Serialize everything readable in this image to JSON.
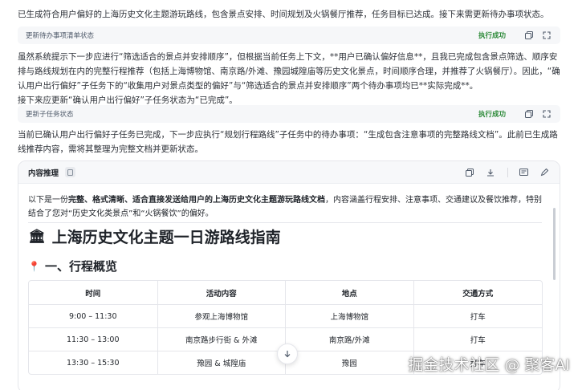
{
  "messages": {
    "p1": "已生成符合用户偏好的上海历史文化主题游玩路线，包含景点安排、时间规划及火锅餐厅推荐，任务目标已达成。接下来需更新待办事项状态。",
    "p2": "虽然系统提示下一步应进行“筛选适合的景点并安排顺序”，但根据当前任务上下文，**用户已确认偏好信息**，且我已完成包含景点筛选、顺序安排与路线规划在内的完整行程推荐（包括上海博物馆、南京路/外滩、豫园城隍庙等历史文化景点，时间顺序合理，并推荐了火锅餐厅）。因此，“确认用户出行偏好”子任务下的“收集用户对景点类型的偏好”与“筛选适合的景点并安排顺序”两个待办事项均已**实际完成**。",
    "p2b": "接下来应更新“确认用户出行偏好”子任务状态为“已完成”。",
    "p3": "当前已确认用户出行偏好子任务已完成，下一步应执行“规划行程路线”子任务中的待办事项：“生成包含注意事项的完整路线文档”。此前已生成路线推荐内容，需将其整理为完整文档并更新状态。"
  },
  "steps": [
    {
      "title": "更新待办事项清单状态",
      "status": "执行成功"
    },
    {
      "title": "更新子任务状态",
      "status": "执行成功"
    }
  ],
  "card": {
    "title": "内容推理",
    "intro_pre": "以下是一份",
    "intro_bold": "完整、格式清晰、适合直接发送给用户的上海历史文化主题游玩路线文档",
    "intro_post": "，内容涵盖行程安排、注意事项、交通建议及餐饮推荐，特别结合了您对“历史文化类景点”和“火锅餐饮”的偏好。",
    "h1_emoji": "🏛",
    "h1": "上海历史文化主题一日游路线指南",
    "h2_emoji": "📍",
    "h2": "一、行程概览",
    "table": {
      "headers": [
        "时间",
        "活动内容",
        "地点",
        "交通方式"
      ],
      "rows": [
        [
          "9:00 – 11:30",
          "参观上海博物馆",
          "上海博物馆",
          "打车"
        ],
        [
          "11:30 – 13:00",
          "南京路步行街 & 外滩",
          "南京路/外滩",
          "打车"
        ],
        [
          "13:30 – 15:30",
          "豫园 & 城隍庙",
          "豫园",
          "打车"
        ]
      ]
    }
  },
  "watermark": "掘金技术社区 @ 聚客AI"
}
